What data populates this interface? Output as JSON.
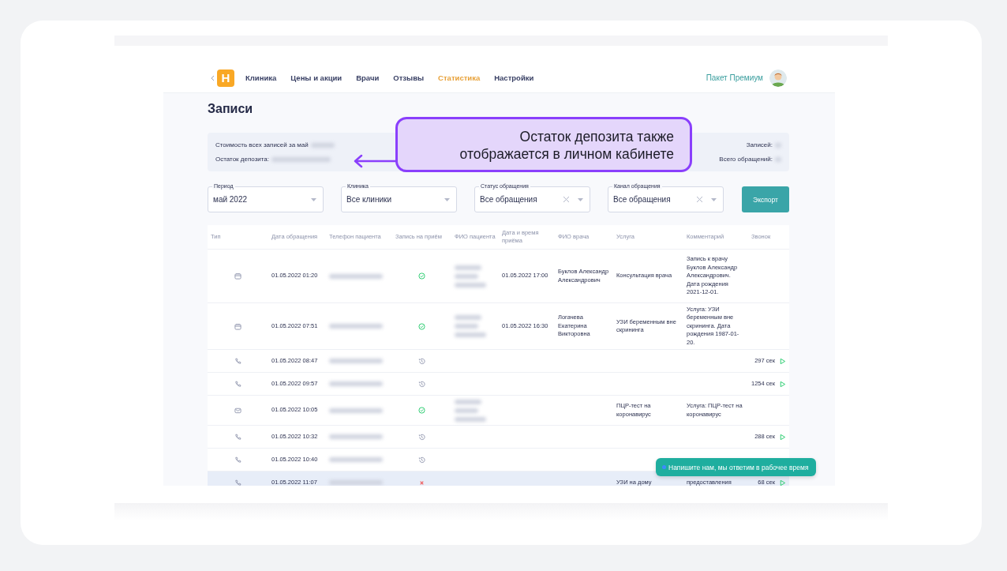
{
  "nav": {
    "items": [
      {
        "label": "Клиника",
        "selected": false
      },
      {
        "label": "Цены и акции",
        "selected": false
      },
      {
        "label": "Врачи",
        "selected": false
      },
      {
        "label": "Отзывы",
        "selected": false
      },
      {
        "label": "Статистика",
        "selected": true
      },
      {
        "label": "Настройки",
        "selected": false
      }
    ],
    "logo": "H",
    "plan": "Пакет Премиум"
  },
  "title": "Записи",
  "summary": {
    "left": [
      "Стоимость всех записей за май",
      "Остаток депозита:"
    ],
    "right": [
      "Записей:",
      "Всего обращений:"
    ]
  },
  "filters": [
    {
      "label": "Период",
      "value": "май 2022",
      "clearable": false
    },
    {
      "label": "Клиника",
      "value": "Все клиники",
      "clearable": false
    },
    {
      "label": "Статус обращения",
      "value": "Все обращения",
      "clearable": true
    },
    {
      "label": "Канал обращения",
      "value": "Все обращения",
      "clearable": true
    }
  ],
  "export_button": "Экспорт",
  "table": {
    "columns": [
      "Тип",
      "Дата обращения",
      "Телефон пациента",
      "Запись на приём",
      "ФИО пациента",
      "Дата и время приёма",
      "ФИО врача",
      "Услуга",
      "Комментарий",
      "Звонок"
    ],
    "rows": [
      {
        "type": {
          "kind": "calendar"
        },
        "date": "01.05.2022 01:20",
        "booking": {
          "kind": "booked"
        },
        "patient_hidden": true,
        "appointment": "01.05.2022 17:00",
        "doctor": "Буклов Александр Александрович",
        "service": "Консультация врача",
        "comment": "Запись к врачу Буклов Александр Александрович. Дата рождения 2021-12-01.",
        "call": null,
        "selected": false
      },
      {
        "type": {
          "kind": "calendar"
        },
        "date": "01.05.2022 07:51",
        "booking": {
          "kind": "booked"
        },
        "patient_hidden": true,
        "appointment": "01.05.2022 16:30",
        "doctor": "Логачева Екатерина Викторовна",
        "service": "УЗИ беременным вне скрининга",
        "comment": "Услуга: УЗИ беременным вне скрининга. Дата рождения 1987-01-20.",
        "call": null,
        "selected": false
      },
      {
        "type": {
          "kind": "phone"
        },
        "date": "01.05.2022 08:47",
        "booking": {
          "kind": "pending"
        },
        "patient_hidden": false,
        "appointment": null,
        "doctor": null,
        "service": null,
        "comment": null,
        "call": "297 сек",
        "selected": false
      },
      {
        "type": {
          "kind": "phone"
        },
        "date": "01.05.2022 09:57",
        "booking": {
          "kind": "pending"
        },
        "patient_hidden": false,
        "appointment": null,
        "doctor": null,
        "service": null,
        "comment": null,
        "call": "1254 сек",
        "selected": false
      },
      {
        "type": {
          "kind": "mail"
        },
        "date": "01.05.2022 10:05",
        "booking": {
          "kind": "booked"
        },
        "patient_hidden": true,
        "appointment": null,
        "doctor": null,
        "service": "ПЦР-тест на коронавирус",
        "comment": "Услуга: ПЦР-тест на коронавирус",
        "call": null,
        "selected": false
      },
      {
        "type": {
          "kind": "phone"
        },
        "date": "01.05.2022 10:32",
        "booking": {
          "kind": "pending"
        },
        "patient_hidden": false,
        "appointment": null,
        "doctor": null,
        "service": null,
        "comment": null,
        "call": "288 сек",
        "selected": false
      },
      {
        "type": {
          "kind": "phone"
        },
        "date": "01.05.2022 10:40",
        "booking": {
          "kind": "pending"
        },
        "patient_hidden": false,
        "appointment": null,
        "doctor": null,
        "service": null,
        "comment": null,
        "call": null,
        "selected": false
      },
      {
        "type": {
          "kind": "phone"
        },
        "date": "01.05.2022 11:07",
        "booking": {
          "kind": "cancelled"
        },
        "patient_hidden": false,
        "appointment": null,
        "doctor": null,
        "service": "УЗИ на дому",
        "comment": "предоставления",
        "call": "68 сек",
        "selected": true
      }
    ]
  },
  "callout": "Остаток депозита также отображается в личном кабинете",
  "toast": "Напишите нам, мы ответим в рабочее время"
}
